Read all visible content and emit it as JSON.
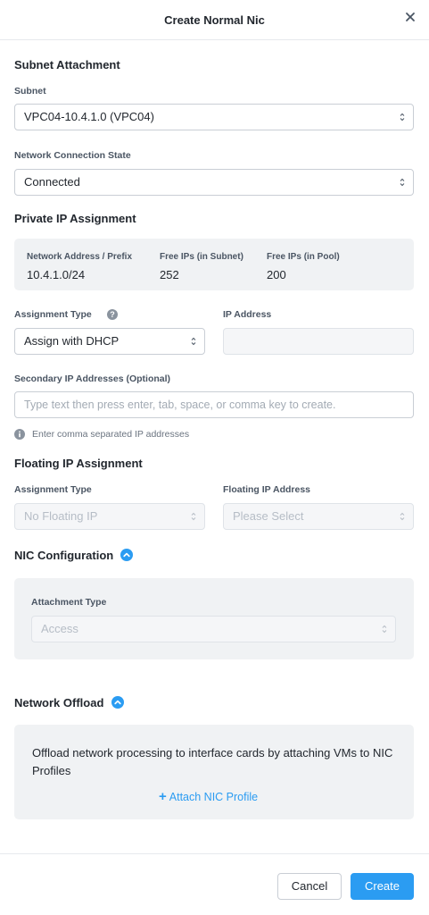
{
  "header": {
    "title": "Create Normal Nic"
  },
  "subnet_attachment": {
    "section_title": "Subnet Attachment",
    "subnet_label": "Subnet",
    "subnet_value": "VPC04-10.4.1.0 (VPC04)",
    "connection_label": "Network Connection State",
    "connection_value": "Connected"
  },
  "private_ip": {
    "section_title": "Private IP Assignment",
    "stats": [
      {
        "label": "Network Address / Prefix",
        "value": "10.4.1.0/24"
      },
      {
        "label": "Free IPs (in Subnet)",
        "value": "252"
      },
      {
        "label": "Free IPs (in Pool)",
        "value": "200"
      }
    ],
    "assignment_type_label": "Assignment Type",
    "assignment_type_value": "Assign with DHCP",
    "ip_address_label": "IP Address",
    "ip_address_value": "",
    "secondary_label": "Secondary IP Addresses (Optional)",
    "secondary_placeholder": "Type text then press enter, tab, space, or comma key to create.",
    "hint": "Enter comma separated IP addresses"
  },
  "floating_ip": {
    "section_title": "Floating IP Assignment",
    "assignment_type_label": "Assignment Type",
    "assignment_type_value": "No Floating IP",
    "floating_label": "Floating IP Address",
    "floating_value": "Please Select"
  },
  "nic_config": {
    "section_title": "NIC Configuration",
    "attachment_label": "Attachment Type",
    "attachment_value": "Access"
  },
  "network_offload": {
    "section_title": "Network Offload",
    "description": "Offload network processing to interface cards by attaching VMs to NIC Profiles",
    "attach_link": "Attach NIC Profile"
  },
  "footer": {
    "cancel_label": "Cancel",
    "create_label": "Create"
  },
  "colors": {
    "accent": "#2b9cf2",
    "text": "#22272e",
    "panel": "#f0f2f4"
  }
}
